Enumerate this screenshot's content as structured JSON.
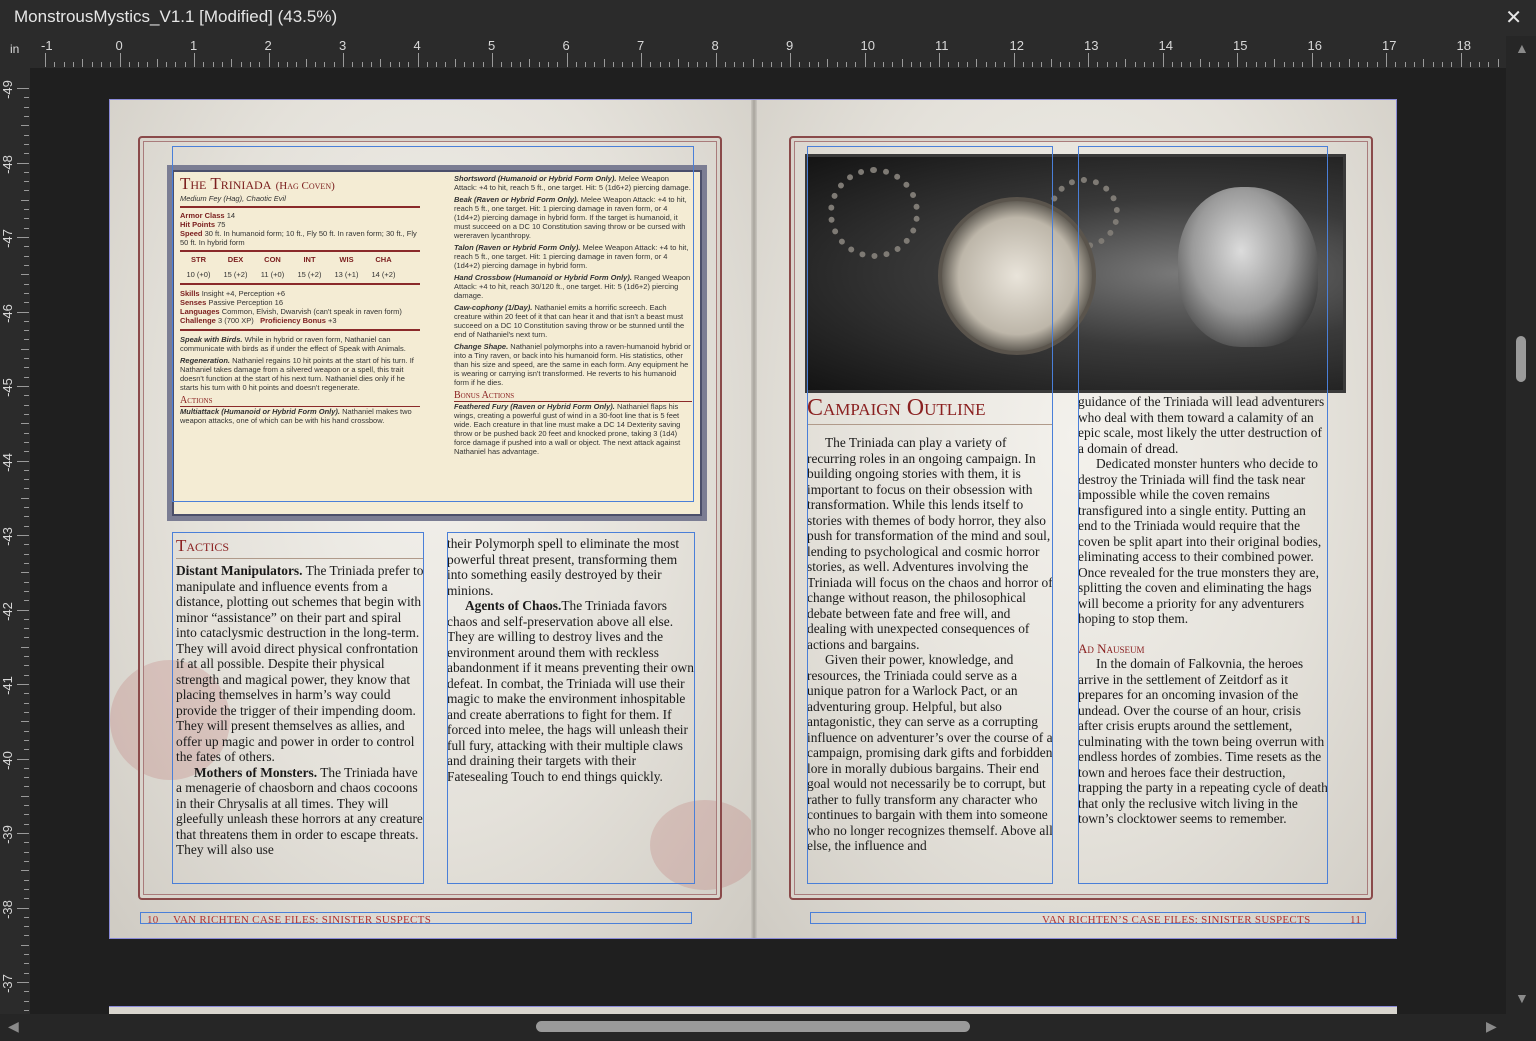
{
  "window": {
    "title": "MonstrousMystics_V1.1 [Modified] (43.5%)",
    "close_symbol": "✕"
  },
  "ruler": {
    "unit": "in",
    "h_labels": [
      "-1",
      "0",
      "1",
      "2",
      "3",
      "4",
      "5",
      "6",
      "7",
      "8",
      "9",
      "10",
      "11",
      "12",
      "13",
      "14",
      "15",
      "16",
      "17",
      "18"
    ],
    "v_labels": [
      "-49",
      "-48",
      "-47",
      "-46",
      "-45",
      "-44",
      "-43",
      "-42",
      "-41",
      "-40",
      "-39",
      "-38",
      "-37"
    ]
  },
  "left_page": {
    "statblock": {
      "title": "The Triniada",
      "title_suffix": "(Hag Coven)",
      "subtitle": "Medium Fey (Hag), Chaotic Evil",
      "armor_class_label": "Armor Class",
      "armor_class": "14",
      "hit_points_label": "Hit Points",
      "hit_points": "75",
      "speed_label": "Speed",
      "speed": "30 ft. In humanoid form; 10 ft., Fly 50 ft. In raven form; 30 ft., Fly 50 ft. In hybrid form",
      "abilities": [
        {
          "name": "STR",
          "value": "10 (+0)"
        },
        {
          "name": "DEX",
          "value": "15 (+2)"
        },
        {
          "name": "CON",
          "value": "11 (+0)"
        },
        {
          "name": "INT",
          "value": "15 (+2)"
        },
        {
          "name": "WIS",
          "value": "13 (+1)"
        },
        {
          "name": "CHA",
          "value": "14 (+2)"
        }
      ],
      "skills_label": "Skills",
      "skills": "Insight +4, Perception +6",
      "senses_label": "Senses",
      "senses": "Passive Perception 16",
      "languages_label": "Languages",
      "languages": "Common, Elvish, Dwarvish (can't speak in raven form)",
      "challenge_label": "Challenge",
      "challenge": "3 (700 XP)",
      "proficiency_label": "Proficiency Bonus",
      "proficiency": "+3",
      "traits": [
        {
          "name": "Speak with Birds.",
          "text": "While in hybrid or raven form, Nathaniel can communicate with birds as if under the effect of Speak with Animals."
        },
        {
          "name": "Regeneration.",
          "text": "Nathaniel regains 10 hit points at the start of his turn. If Nathaniel takes damage from a silvered weapon or a spell, this trait doesn't function at the start of his next turn. Nathaniel dies only if he starts his turn with 0 hit points and doesn't regenerate."
        }
      ],
      "actions_heading": "Actions",
      "actions": [
        {
          "name": "Multiattack (Humanoid or Hybrid Form Only).",
          "text": "Nathaniel makes two weapon attacks, one of which can be with his hand crossbow."
        },
        {
          "name": "Shortsword (Humanoid or Hybrid Form Only).",
          "text": "Melee Weapon Attack: +4 to hit, reach 5 ft., one target. Hit: 5 (1d6+2) piercing damage."
        },
        {
          "name": "Beak (Raven or Hybrid Form Only).",
          "text": "Melee Weapon Attack: +4 to hit, reach 5 ft., one target. Hit: 1 piercing damage in raven form, or 4 (1d4+2) piercing damage in hybrid form. If the target is humanoid, it must succeed on a DC 10 Constitution saving throw or be cursed with wereraven lycanthropy."
        },
        {
          "name": "Talon (Raven or Hybrid Form Only).",
          "text": "Melee Weapon Attack: +4 to hit, reach 5 ft., one target. Hit: 1 piercing damage in raven form, or 4 (1d4+2) piercing damage in hybrid form."
        },
        {
          "name": "Hand Crossbow (Humanoid or Hybrid Form Only).",
          "text": "Ranged Weapon Attack: +4 to hit, reach 30/120 ft., one target. Hit: 5 (1d6+2) piercing damage."
        },
        {
          "name": "Caw-cophony (1/Day).",
          "text": "Nathaniel emits a horrific screech. Each creature within 20 feet of it that can hear it and that isn't a beast must succeed on a DC 10 Constitution saving throw or be stunned until the end of Nathaniel's next turn."
        },
        {
          "name": "Change Shape.",
          "text": "Nathaniel polymorphs into a raven-humanoid hybrid or into a Tiny raven, or back into his humanoid form. His statistics, other than his size and speed, are the same in each form. Any equipment he is wearing or carrying isn't transformed. He reverts to his humanoid form if he dies."
        }
      ],
      "bonus_heading": "Bonus Actions",
      "bonus": {
        "name": "Feathered Fury (Raven or Hybrid Form Only).",
        "text": "Nathaniel flaps his wings, creating a powerful gust of wind in a 30-foot line that is 5 feet wide. Each creature in that line must make a DC 14 Dexterity saving throw or be pushed back 20 feet and knocked prone, taking 3 (1d4) force damage if pushed into a wall or object. The next attack against Nathaniel has advantage."
      }
    },
    "tactics_heading": "Tactics",
    "col1": {
      "p1_bold": "Distant Manipulators.",
      "p1": " The Triniada prefer to manipulate and influence events from a distance, plotting out schemes that begin with minor “assistance” on their part and spiral into cataclysmic destruction in the long-term. They will avoid direct physical confrontation if at all possible. Despite their physical strength and magical power, they know that placing themselves in harm’s way could provide the trigger of their impending doom. They will present themselves as allies, and offer up magic and power in order to control the fates of others.",
      "p2_bold": "Mothers of Monsters.",
      "p2": " The Triniada have a menagerie of chaosborn and chaos cocoons in their Chrysalis at all times. They will gleefully unleash these horrors at any creature that threatens them in order to escape threats. They will also use"
    },
    "col2": {
      "p1": "their Polymorph spell to eliminate the most powerful threat present, transforming them into something easily destroyed by their minions.",
      "p2_bold": "Agents of Chaos.",
      "p2": "The Triniada favors chaos and self-preservation above all else. They are willing to destroy lives and the environment around them with reckless abandonment if it means preventing their own defeat. In combat, the Triniada will use their magic to make the environment inhospitable and create aberrations to fight for them. If forced into melee, the hags will unleash their full fury, attacking with their multiple claws and draining their targets with their Fatesealing Touch to end things quickly."
    },
    "page_number": "10",
    "footer": "VAN RICHTEN CASE FILES: SINISTER SUSPECTS"
  },
  "right_page": {
    "heading": "Campaign Outline",
    "col1": {
      "p1": "The Triniada can play a variety of recurring roles in an ongoing campaign. In building ongoing stories with them, it is important to focus on their obsession with transformation. While this lends itself to stories with themes of body horror, they also push for transformation of the mind and soul, lending to psychological and cosmic horror stories, as well. Adventures involving the Triniada will focus on the chaos and horror of change without reason, the philosophical debate between fate and free will, and dealing with unexpected consequences of actions and bargains.",
      "p2": "Given their power, knowledge, and resources, the Triniada could serve as a unique patron for a Warlock Pact, or an adventuring group. Helpful, but also antagonistic, they can serve as a corrupting influence on adventurer’s over the course of a campaign, promising dark gifts and forbidden lore in morally dubious bargains. Their end goal would not necessarily be to corrupt, but rather to fully transform any character who continues to bargain with them into someone who no longer recognizes themself. Above all else, the influence and"
    },
    "col2": {
      "p1": "guidance of the Triniada will lead adventurers who deal with them toward a calamity of an epic scale, most likely the utter destruction of a domain of dread.",
      "p2": "Dedicated monster hunters who decide to destroy the Triniada will find the task near impossible while the coven remains transfigured into a single entity. Putting an end to the Triniada would require that the coven be split apart into their original bodies, eliminating access to their combined power. Once revealed for the true monsters they are, splitting the coven and eliminating the hags will become a priority for any adventurers hoping to stop them.",
      "subheading": "Ad Nauseum",
      "p3": "In the domain of Falkovnia, the heroes arrive in the settlement of Zeitdorf as it prepares for an oncoming invasion of the undead. Over the course of an hour, crisis after crisis erupts around the settlement, culminating with the town being overrun with endless hordes of zombies. Time resets as the town and heroes face their destruction, trapping the party in a repeating cycle of death that only the reclusive witch living in the town’s clocktower seems to remember."
    },
    "page_number": "11",
    "footer": "VAN RICHTEN’S CASE FILES: SINISTER SUSPECTS"
  },
  "pilcrow": "¶",
  "colors": {
    "accent": "#4a7fd8",
    "heading_red": "#8a2020",
    "footer_red": "#b03030"
  }
}
